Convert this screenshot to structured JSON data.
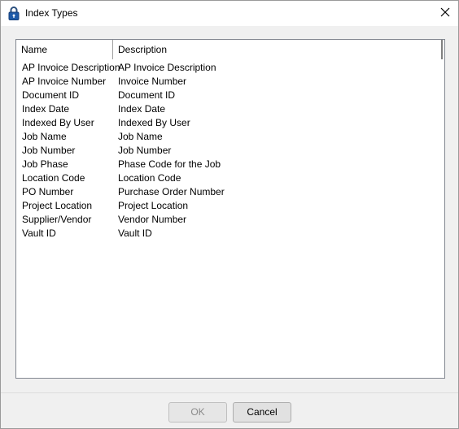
{
  "window": {
    "title": "Index Types"
  },
  "list": {
    "columns": {
      "name": "Name",
      "description": "Description"
    },
    "rows": [
      {
        "name": "AP Invoice Description",
        "description": "AP Invoice Description"
      },
      {
        "name": "AP Invoice Number",
        "description": "Invoice Number"
      },
      {
        "name": "Document ID",
        "description": "Document ID"
      },
      {
        "name": "Index Date",
        "description": "Index Date"
      },
      {
        "name": "Indexed By User",
        "description": "Indexed By User"
      },
      {
        "name": "Job Name",
        "description": "Job Name"
      },
      {
        "name": "Job Number",
        "description": "Job Number"
      },
      {
        "name": "Job Phase",
        "description": "Phase Code for the Job"
      },
      {
        "name": "Location Code",
        "description": "Location Code"
      },
      {
        "name": "PO Number",
        "description": "Purchase Order Number"
      },
      {
        "name": "Project Location",
        "description": "Project Location"
      },
      {
        "name": "Supplier/Vendor",
        "description": "Vendor Number"
      },
      {
        "name": "Vault ID",
        "description": "Vault ID"
      }
    ]
  },
  "buttons": {
    "ok": "OK",
    "cancel": "Cancel"
  },
  "icons": {
    "title": "padlock-icon",
    "close": "close-icon"
  },
  "colors": {
    "window_bg": "#f0f0f0",
    "list_bg": "#ffffff",
    "lock_blue": "#1e5aa8"
  }
}
